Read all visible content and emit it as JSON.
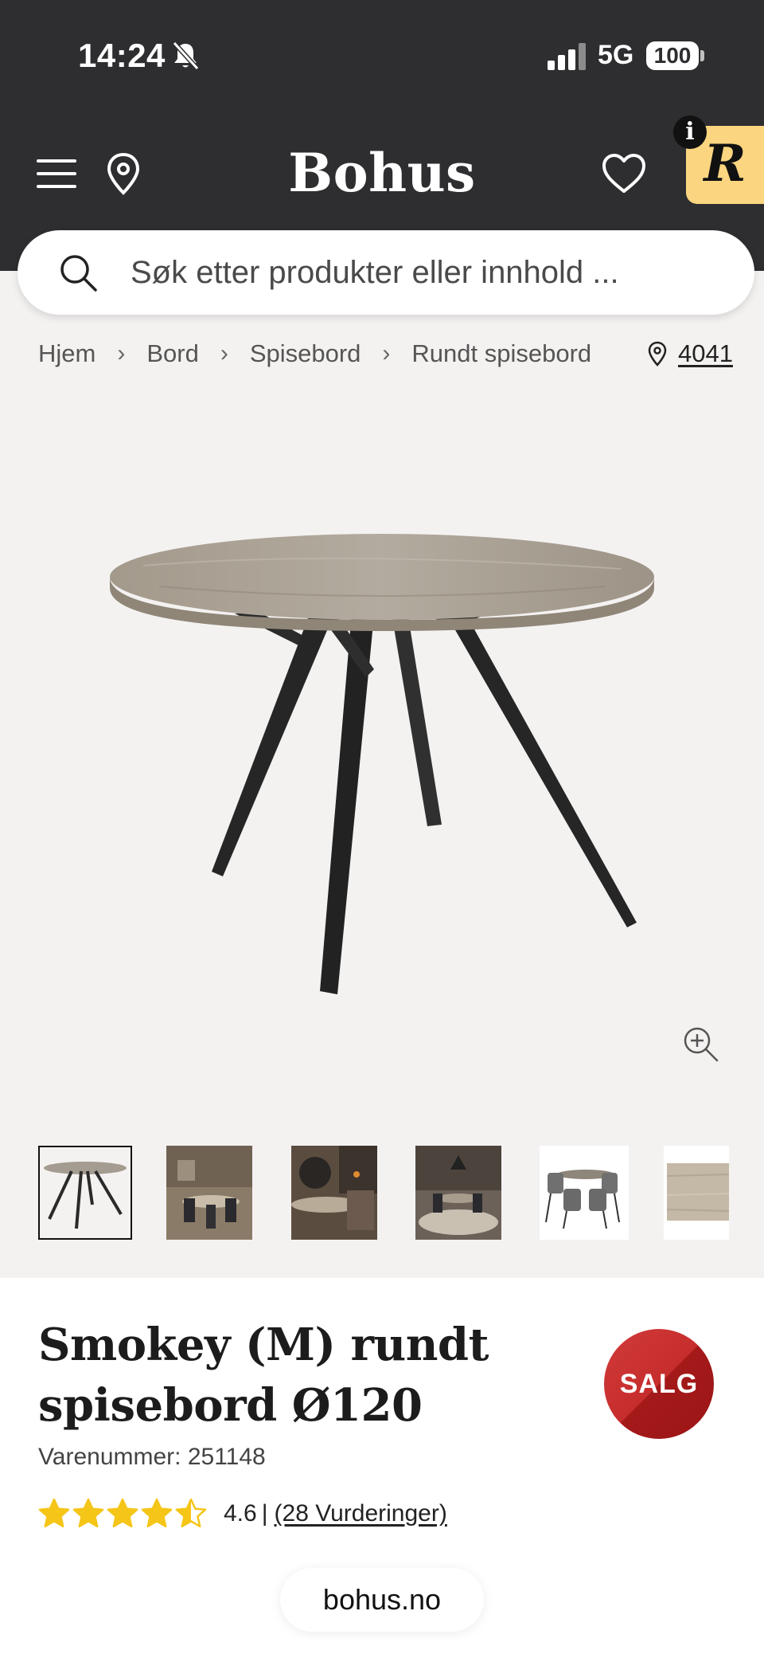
{
  "status_bar": {
    "time": "14:24",
    "network": "5G",
    "battery": "100"
  },
  "header": {
    "logo": "Bohus",
    "badge_letter": "R",
    "info_label": "i"
  },
  "search": {
    "placeholder": "Søk etter produkter eller innhold ..."
  },
  "breadcrumb": {
    "items": [
      "Hjem",
      "Bord",
      "Spisebord",
      "Rundt spisebord"
    ],
    "separator": "›"
  },
  "location": {
    "postcode": "4041"
  },
  "product": {
    "title": "Smokey (M) rundt spisebord Ø120",
    "sku_label": "Varenummer: 251148",
    "sale_badge": "SALG",
    "rating": 4.6,
    "rating_text": "4.6",
    "rating_sep": "|",
    "reviews_text": "(28 Vurderinger)",
    "thumbnail_count": 6,
    "selected_thumbnail": 0
  },
  "browser": {
    "url": "bohus.no"
  },
  "colors": {
    "header_bg": "#2e2e31",
    "image_bg": "#f4f2f1",
    "star": "#f5c518",
    "sale": "#c62d2d",
    "badge": "#fbd580"
  },
  "icons": [
    "bell-off-icon",
    "signal-icon",
    "menu-icon",
    "location-pin-icon",
    "heart-icon",
    "search-icon",
    "chevron-right-icon",
    "zoom-in-icon",
    "star-icon"
  ]
}
